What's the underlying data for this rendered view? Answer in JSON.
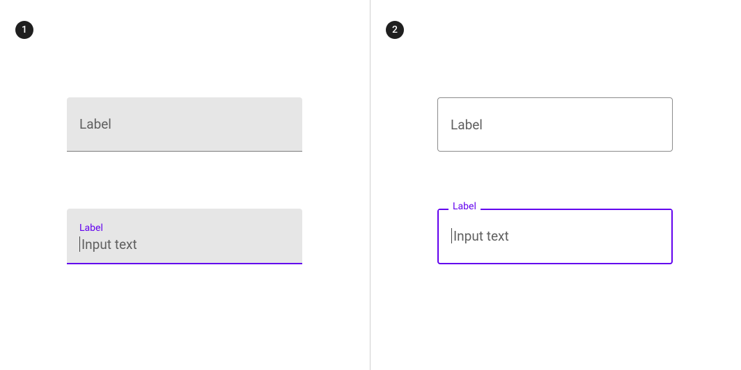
{
  "panels": {
    "left": {
      "badge": "1"
    },
    "right": {
      "badge": "2"
    }
  },
  "filled": {
    "idle": {
      "label": "Label"
    },
    "focused": {
      "label": "Label",
      "value": "Input text"
    }
  },
  "outlined": {
    "idle": {
      "label": "Label"
    },
    "focused": {
      "label": "Label",
      "value": "Input text"
    }
  },
  "colors": {
    "primary": "#6200ee",
    "surface_variant": "#e6e6e6",
    "outline": "#8a8a8a"
  }
}
